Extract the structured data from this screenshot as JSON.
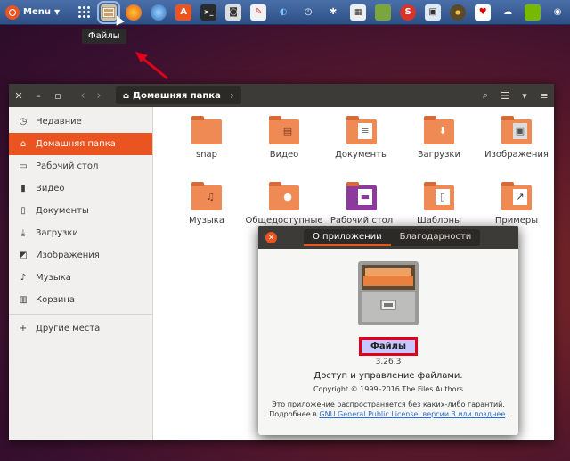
{
  "panel": {
    "menu_label": "Menu",
    "tooltip": "Файлы"
  },
  "window": {
    "path_label": "Домашняя папка"
  },
  "sidebar": {
    "items": [
      {
        "label": "Недавние",
        "icon": "clock-icon"
      },
      {
        "label": "Домашняя папка",
        "icon": "home-icon",
        "active": true
      },
      {
        "label": "Рабочий стол",
        "icon": "desktop-icon"
      },
      {
        "label": "Видео",
        "icon": "video-icon"
      },
      {
        "label": "Документы",
        "icon": "document-icon"
      },
      {
        "label": "Загрузки",
        "icon": "download-icon"
      },
      {
        "label": "Изображения",
        "icon": "image-icon"
      },
      {
        "label": "Музыка",
        "icon": "music-icon"
      },
      {
        "label": "Корзина",
        "icon": "trash-icon"
      }
    ],
    "other_places": "Другие места"
  },
  "files": [
    {
      "label": "snap"
    },
    {
      "label": "Видео"
    },
    {
      "label": "Документы"
    },
    {
      "label": "Загрузки"
    },
    {
      "label": "Изображения"
    },
    {
      "label": "Музыка"
    },
    {
      "label": "Общедоступные"
    },
    {
      "label": "Рабочий стол"
    },
    {
      "label": "Шаблоны"
    },
    {
      "label": "Примеры"
    }
  ],
  "about": {
    "tabs": [
      "О приложении",
      "Благодарности"
    ],
    "app_name": "Файлы",
    "version": "3.26.3",
    "description": "Доступ и управление файлами.",
    "copyright": "Copyright © 1999–2016 The Files Authors",
    "license_line1": "Это приложение распространяется без каких-либо гарантий.",
    "license_prefix": "Подробнее в ",
    "license_link": "GNU General Public License, версии 3 или позднее",
    "license_suffix": "."
  },
  "colors": {
    "accent": "#e95420",
    "highlight_border": "#e0001a"
  }
}
